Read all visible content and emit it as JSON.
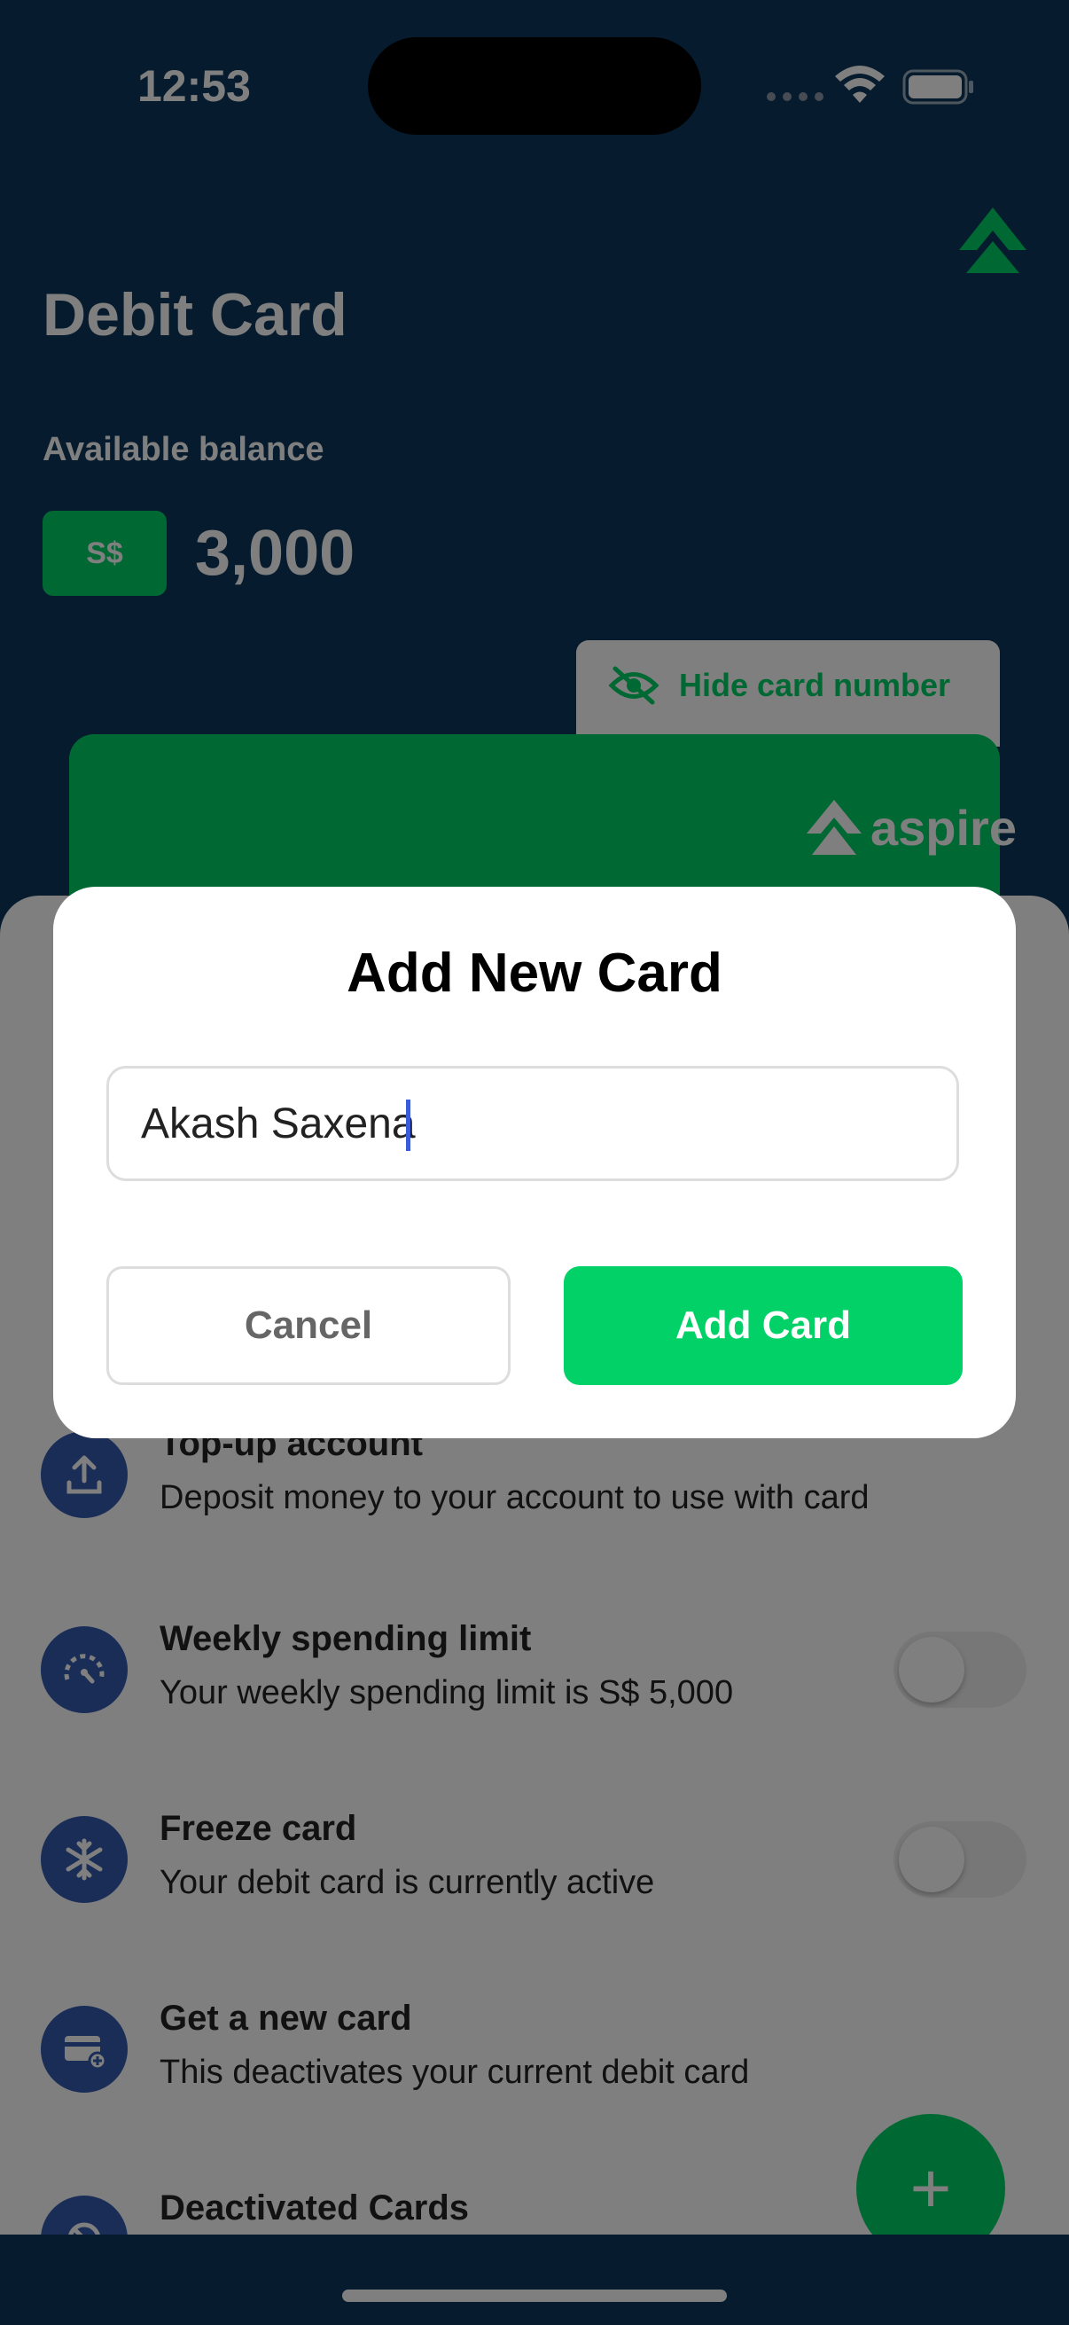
{
  "status_bar": {
    "time": "12:53"
  },
  "header": {
    "title": "Debit Card",
    "balance_label": "Available balance",
    "currency": "S$",
    "balance": "3,000"
  },
  "card": {
    "hide_label": "Hide card number",
    "brand": "aspire"
  },
  "menu": [
    {
      "title": "Top-up account",
      "subtitle": "Deposit money to your account to use with card",
      "icon": "upload-icon",
      "has_toggle": false
    },
    {
      "title": "Weekly spending limit",
      "subtitle": "Your weekly spending limit is S$ 5,000",
      "icon": "speedometer-icon",
      "has_toggle": true,
      "toggle_on": false
    },
    {
      "title": "Freeze card",
      "subtitle": "Your debit card is currently active",
      "icon": "snowflake-icon",
      "has_toggle": true,
      "toggle_on": false
    },
    {
      "title": "Get a new card",
      "subtitle": "This deactivates your current debit card",
      "icon": "new-card-icon",
      "has_toggle": false
    },
    {
      "title": "Deactivated Cards",
      "subtitle": "",
      "icon": "deactivated-card-icon",
      "has_toggle": false
    }
  ],
  "fab": {
    "label": "+"
  },
  "dialog": {
    "title": "Add New Card",
    "input_value": "Akash Saxena",
    "cancel_label": "Cancel",
    "add_label": "Add Card"
  },
  "colors": {
    "navy": "#0C365A",
    "brand_green": "#01D167",
    "icon_blue": "#325BAF"
  }
}
